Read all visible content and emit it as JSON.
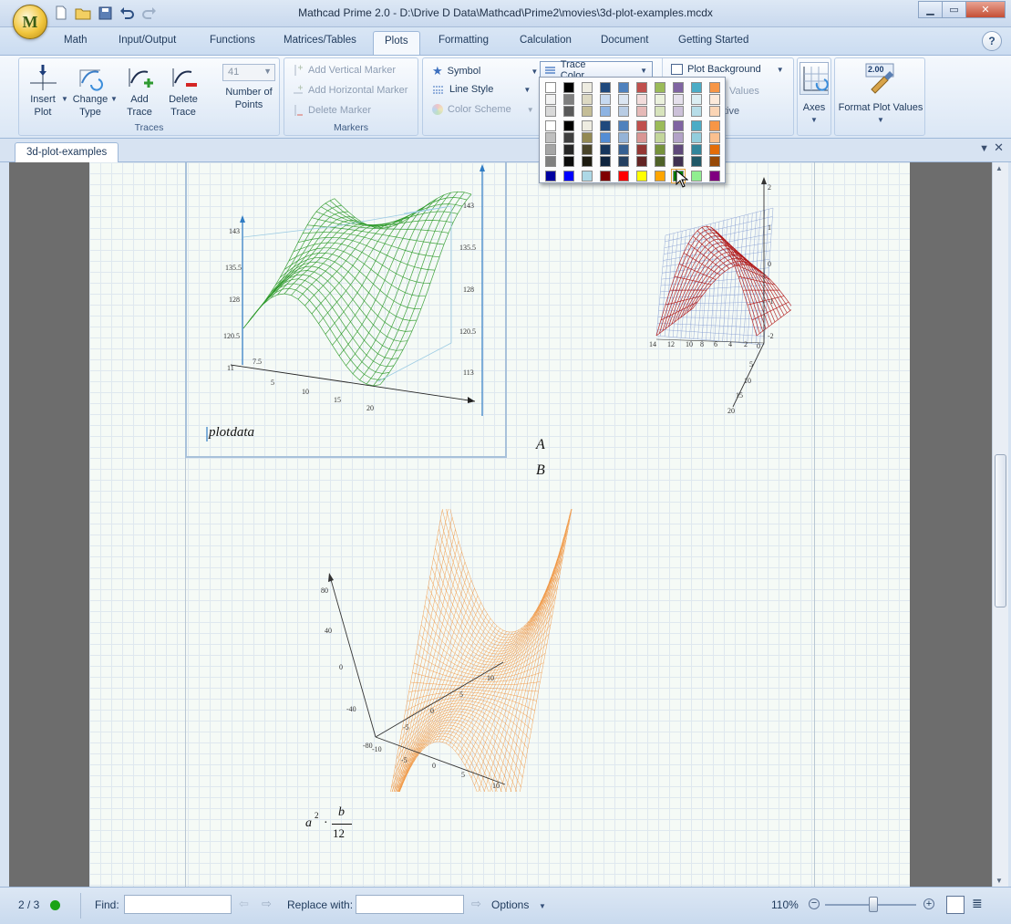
{
  "window": {
    "title": "Mathcad Prime 2.0 - D:\\Drive D Data\\Mathcad\\Prime2\\movies\\3d-plot-examples.mcdx",
    "app_badge": "M"
  },
  "ribbon_tabs": [
    "Math",
    "Input/Output",
    "Functions",
    "Matrices/Tables",
    "Plots",
    "Formatting",
    "Calculation",
    "Document",
    "Getting Started"
  ],
  "active_tab": "Plots",
  "ribbon": {
    "traces": {
      "label": "Traces",
      "insert_plot": "Insert Plot",
      "change_type": "Change Type",
      "add_trace": "Add Trace",
      "delete_trace": "Delete Trace",
      "number_of_points_label": "Number of Points",
      "number_of_points_value": "41"
    },
    "markers": {
      "label": "Markers",
      "add_vertical": "Add Vertical Marker",
      "add_horizontal": "Add Horizontal Marker",
      "delete_marker": "Delete Marker"
    },
    "style": {
      "symbol": "Symbol",
      "line_style": "Line Style",
      "color_scheme": "Color Scheme",
      "trace_color": "Trace Color"
    },
    "background": {
      "plot_background": "Plot Background",
      "values_partial": "Values",
      "tive_partial": "tive"
    },
    "axes": "Axes",
    "format_plot_values": "Format Plot Values",
    "format_plot_values_icon_text": "2.00"
  },
  "palette": {
    "rows": [
      [
        "#ffffff",
        "#000000",
        "#eeece1",
        "#1f497d",
        "#4f81bd",
        "#c0504d",
        "#9bbb59",
        "#8064a2",
        "#4bacc6",
        "#f79646"
      ],
      [
        "#f2f2f2",
        "#7f7f7f",
        "#ddd9c3",
        "#c6d9f0",
        "#dbe5f1",
        "#f2dcdb",
        "#ebf1dd",
        "#e5e0ec",
        "#dbeef3",
        "#fdeada"
      ],
      [
        "#d8d8d8",
        "#595959",
        "#c4bd97",
        "#8db3e2",
        "#b8cce4",
        "#e5b9b7",
        "#d7e3bc",
        "#ccc1d9",
        "#b7dde8",
        "#fbd5b5"
      ],
      [
        "#ffffff",
        "#000000",
        "#eeece1",
        "#1f497d",
        "#4f81bd",
        "#c0504d",
        "#9bbb59",
        "#8064a2",
        "#4bacc6",
        "#f79646"
      ],
      [
        "#bfbfbf",
        "#3f3f3f",
        "#938953",
        "#548dd4",
        "#95b3d7",
        "#d99694",
        "#c3d69b",
        "#b2a2c7",
        "#92cddc",
        "#fac08f"
      ],
      [
        "#a5a5a5",
        "#262626",
        "#494429",
        "#17365d",
        "#366092",
        "#953734",
        "#76923c",
        "#5f497a",
        "#31859b",
        "#e36c09"
      ],
      [
        "#7f7f7f",
        "#0c0c0c",
        "#1d1b10",
        "#0f243e",
        "#244061",
        "#632423",
        "#4f6128",
        "#3f3151",
        "#205867",
        "#974806"
      ],
      [
        "#0000a0",
        "#0000ff",
        "#add8e6",
        "#800000",
        "#ff0000",
        "#ffff00",
        "#ffa500",
        "#008000",
        "#90ee90",
        "#800080"
      ]
    ],
    "selected": "#008000"
  },
  "document": {
    "tab_name": "3d-plot-examples",
    "plot1_label": "plotdata",
    "plot1_ticks_z": [
      "143",
      "135.5",
      "128",
      "120.5",
      "113"
    ],
    "plot1_ticks_x": [
      "5",
      "10",
      "15",
      "20"
    ],
    "plot1_tick_75": "7.5",
    "plot1_tick_11": "11",
    "plot1_axis_ticks": [
      "143",
      "135.5",
      "128",
      "120.5",
      "113"
    ],
    "plot2_labels": [
      "A",
      "B"
    ],
    "plot2_ticks": [
      "14",
      "12",
      "10",
      "8",
      "6",
      "4",
      "2",
      "0"
    ],
    "plot2_zticks": [
      "2",
      "1",
      "0",
      "-1",
      "-2"
    ],
    "plot2_yticks": [
      "5",
      "10",
      "15",
      "20"
    ],
    "plot3_zticks": [
      "80",
      "40",
      "0",
      "-40",
      "-80"
    ],
    "plot3_xticks": [
      "-10",
      "-5",
      "0",
      "5",
      "10"
    ],
    "plot3_yticks": [
      "-5",
      "0",
      "5",
      "10"
    ],
    "plot3_expr_a": "a",
    "plot3_expr_exp": "2",
    "plot3_expr_dot": "·",
    "plot3_expr_b": "b",
    "plot3_expr_den": "12"
  },
  "status": {
    "page": "2 / 3",
    "find_label": "Find:",
    "replace_label": "Replace with:",
    "options": "Options",
    "zoom": "110%"
  },
  "colors": {
    "accent": "#1e395b",
    "green_trace": "#2e9a2a",
    "red_trace": "#b01616",
    "orange_trace": "#f08a2a",
    "status_dot": "#1aa316"
  }
}
